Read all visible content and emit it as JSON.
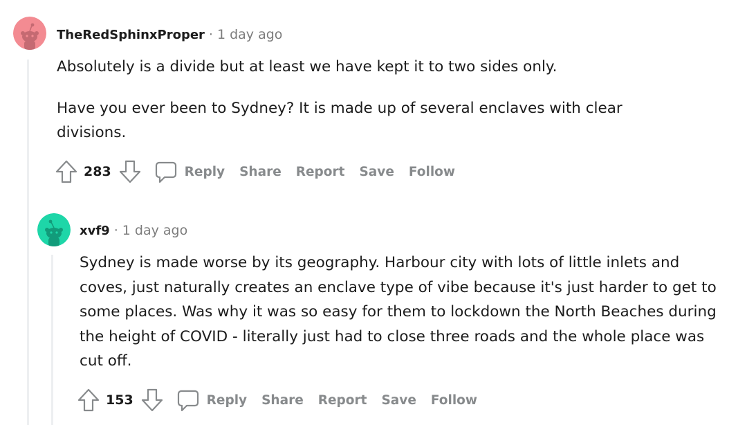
{
  "comments": [
    {
      "username": "TheRedSphinxProper",
      "separator": "·",
      "timestamp": "1 day ago",
      "avatar_color": "#f38b92",
      "paragraphs": [
        "Absolutely is a divide but at least we have kept it to two sides only.",
        "Have you ever been to Sydney? It is made up of several enclaves with clear divisions."
      ],
      "score": "283",
      "actions": {
        "reply": "Reply",
        "share": "Share",
        "report": "Report",
        "save": "Save",
        "follow": "Follow"
      }
    },
    {
      "username": "xvf9",
      "separator": "·",
      "timestamp": "1 day ago",
      "avatar_color": "#1ed6a8",
      "paragraphs": [
        "Sydney is made worse by its geography. Harbour city with lots of little inlets and coves, just naturally creates an enclave type of vibe because it's just harder to get to some places. Was why it was so easy for them to lockdown the North Beaches during the height of COVID - literally just had to close three roads and the whole place was cut off."
      ],
      "score": "153",
      "actions": {
        "reply": "Reply",
        "share": "Share",
        "report": "Report",
        "save": "Save",
        "follow": "Follow"
      }
    }
  ],
  "icons": {
    "upvote": "upvote-arrow-icon",
    "downvote": "downvote-arrow-icon",
    "reply": "speech-bubble-icon",
    "avatar": "snoo-avatar-icon"
  }
}
